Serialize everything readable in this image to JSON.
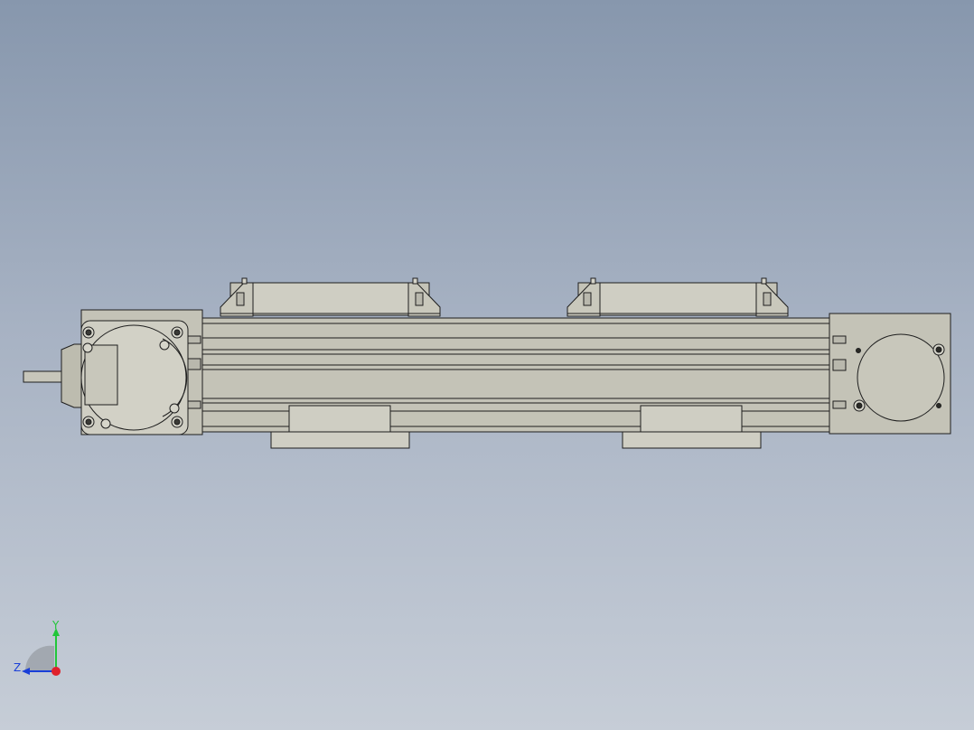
{
  "viewport": {
    "background_top": "#8797ad",
    "background_bottom": "#c6cdd7",
    "part_fill": "#c4c3b7",
    "part_stroke": "#1e1e1e"
  },
  "triad": {
    "axes": {
      "y_label": "Y",
      "z_label": "Z"
    },
    "colors": {
      "y_axis": "#22c63a",
      "z_axis": "#1a3fd8",
      "x_axis": "#e0212b"
    }
  }
}
